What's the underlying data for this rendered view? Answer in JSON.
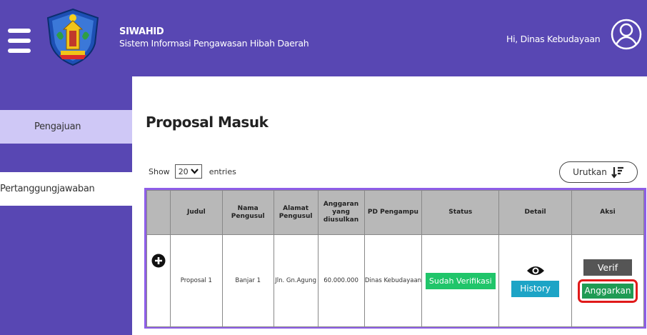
{
  "header": {
    "app_name": "SIWAHID",
    "app_subtitle": "Sistem Informasi Pengawasan Hibah Daerah",
    "greeting": "Hi, Dinas Kebudayaan",
    "colors": {
      "header_bg": "#5847b3"
    },
    "icons": [
      "hamburger-menu-icon",
      "logo-emblem",
      "user-avatar-icon"
    ]
  },
  "sidebar": {
    "items": [
      {
        "label": "Pengajuan",
        "active": true
      },
      {
        "label": "Pertanggungjawaban",
        "active": false
      }
    ]
  },
  "main": {
    "title": "Proposal Masuk",
    "show_label": "Show",
    "entries_value": "20",
    "entries_label": "entries",
    "sort_label": "Urutkan"
  },
  "table": {
    "headers": [
      "",
      "Judul",
      "Nama Pengusul",
      "Alamat Pengusul",
      "Anggaran yang diusulkan",
      "PD Pengampu",
      "Status",
      "Detail",
      "Aksi"
    ],
    "row": {
      "judul": "Proposal 1",
      "nama": "Banjar 1",
      "alamat": "Jln. Gn.Agung",
      "anggaran": "60.000.000",
      "pd": "Dinas Kebudayaan",
      "status": "Sudah Verifikasi",
      "detail_button": "History",
      "verif_button": "Verif",
      "anggarkan_button": "Anggarkan"
    }
  }
}
